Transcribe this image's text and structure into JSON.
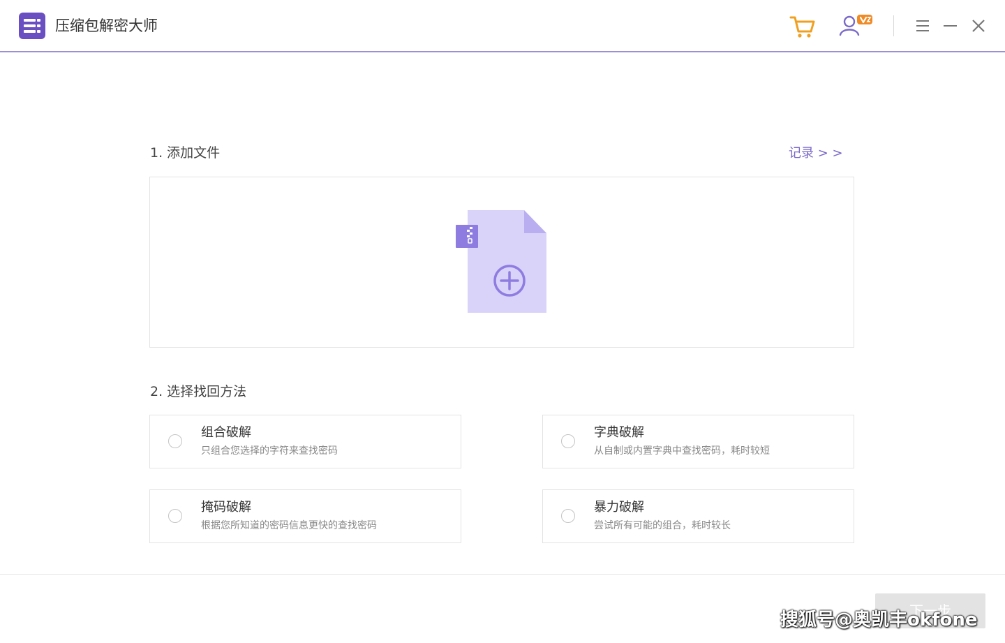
{
  "app": {
    "title": "压缩包解密大师",
    "accent_color": "#7a68c8",
    "logo_color": "#6a4fc2"
  },
  "titlebar": {
    "icons": [
      "cart-icon",
      "user-vip-icon",
      "menu-icon",
      "minimize-icon",
      "close-icon"
    ],
    "vip_badge": "V"
  },
  "step1": {
    "title": "1. 添加文件",
    "records_link": "记录 > >",
    "drop_icon": "zip-file-add-icon"
  },
  "step2": {
    "title": "2. 选择找回方法",
    "options": [
      {
        "title": "组合破解",
        "desc": "只组合您选择的字符来查找密码"
      },
      {
        "title": "字典破解",
        "desc": "从自制或内置字典中查找密码，耗时较短"
      },
      {
        "title": "掩码破解",
        "desc": "根据您所知道的密码信息更快的查找密码"
      },
      {
        "title": "暴力破解",
        "desc": "尝试所有可能的组合，耗时较长"
      }
    ]
  },
  "footer": {
    "next_label": "下一步"
  },
  "watermark": {
    "text": "搜狐号@奥凯丰okfone"
  }
}
